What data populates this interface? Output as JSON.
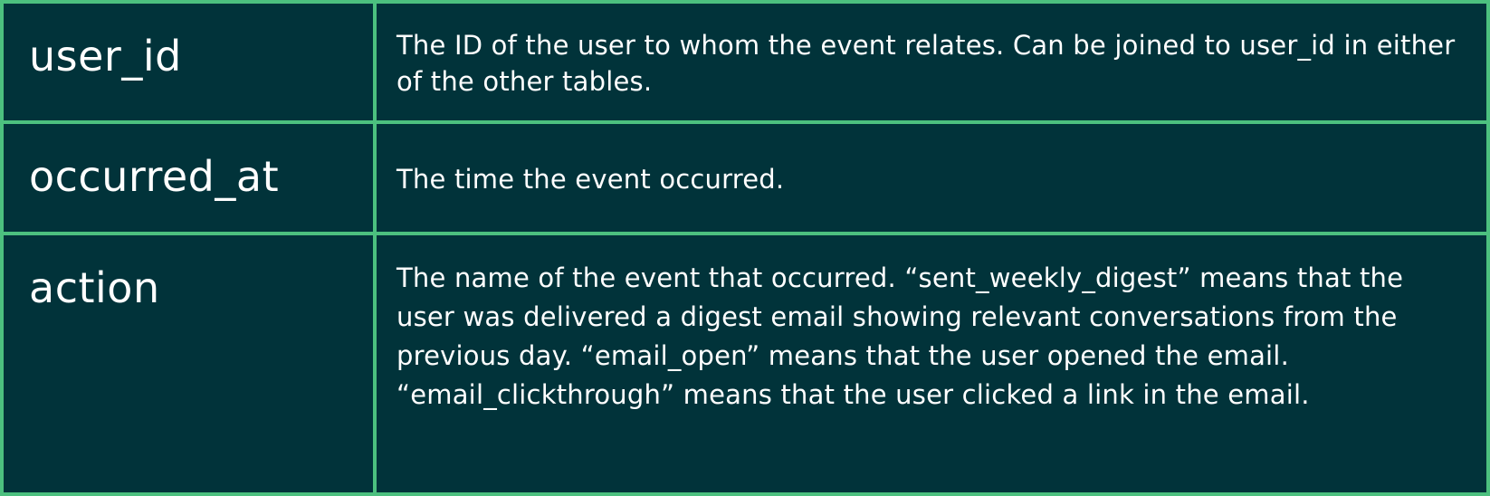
{
  "colors": {
    "background": "#01333a",
    "border": "#4cc07f",
    "text": "#ffffff"
  },
  "rows": [
    {
      "name": "user_id",
      "description": "The ID of the user to whom the event relates. Can be joined to user_id in either of the other tables."
    },
    {
      "name": "occurred_at",
      "description": "The time the event occurred."
    },
    {
      "name": "action",
      "description": "The name of the event that occurred. “sent_weekly_digest” means that the user was delivered a digest email showing relevant conversations from the previous day. “email_open” means that the user opened the email. “email_clickthrough” means that the user clicked a link in the email."
    }
  ]
}
